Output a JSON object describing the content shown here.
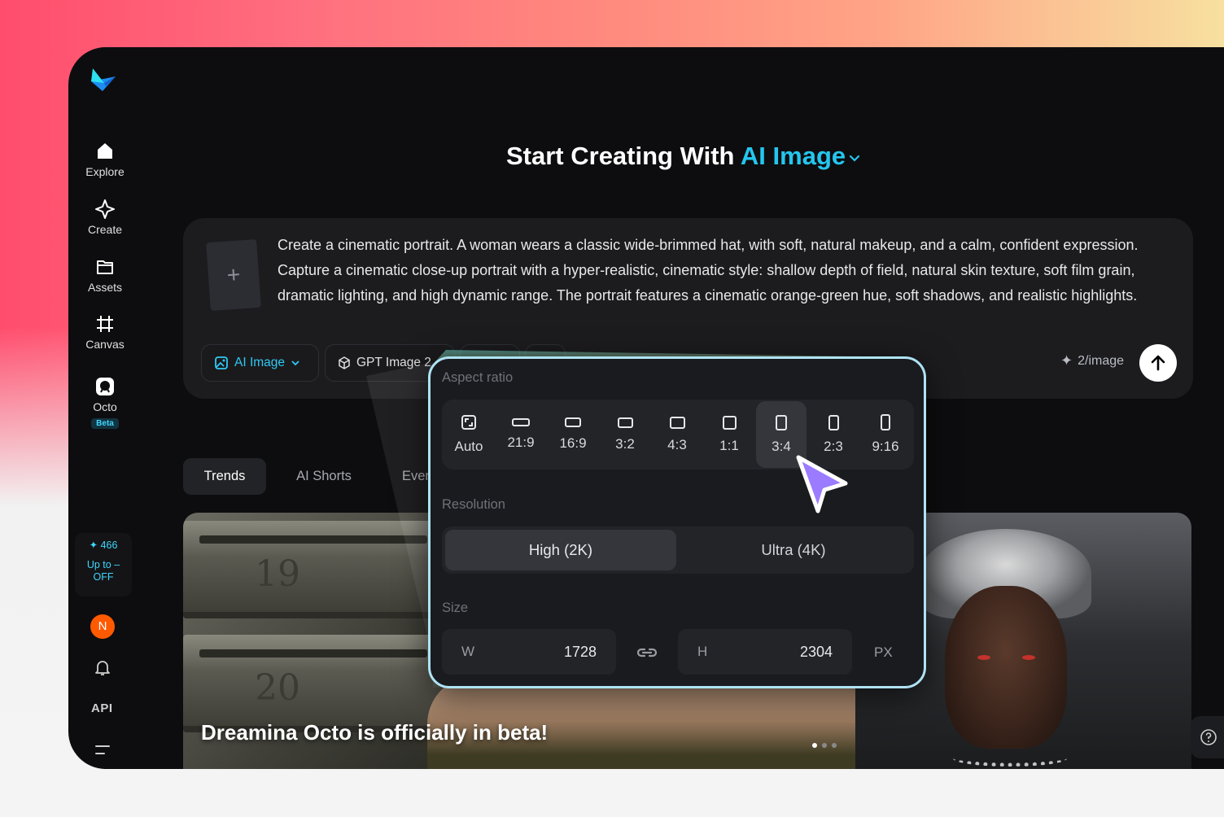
{
  "sidebar": {
    "items": [
      {
        "label": "Explore",
        "icon": "home-icon"
      },
      {
        "label": "Create",
        "icon": "sparkle-icon"
      },
      {
        "label": "Assets",
        "icon": "folder-icon"
      },
      {
        "label": "Canvas",
        "icon": "canvas-icon"
      },
      {
        "label": "Octo",
        "icon": "octo-icon",
        "badge": "Beta"
      }
    ],
    "promo": {
      "credits": "466",
      "line1": "Up to –",
      "line2": "OFF"
    },
    "avatar_letter": "N",
    "api_label": "API"
  },
  "header": {
    "prefix": "Start Creating With",
    "accent": "AI Image"
  },
  "prompt": {
    "text": "Create a cinematic portrait. A woman wears a classic wide-brimmed hat, with soft, natural makeup, and a calm, confident expression. Capture a cinematic close-up portrait with a hyper-realistic, cinematic style: shallow depth of field, natural skin texture, soft film grain, dramatic lighting, and high dynamic range. The portrait features a cinematic orange-green hue, soft shadows, and realistic highlights.",
    "add_glyph": "+",
    "chips": {
      "mode": "AI Image",
      "model": "GPT Image 2"
    },
    "price": "2/image"
  },
  "tabs": [
    {
      "label": "Trends",
      "active": true
    },
    {
      "label": "AI Shorts",
      "active": false
    },
    {
      "label": "Ever",
      "active": false
    }
  ],
  "gallery": {
    "caption": "Dreamina Octo is officially in beta!",
    "mailbox_numbers": [
      "19",
      "20"
    ]
  },
  "popup": {
    "aspect_title": "Aspect ratio",
    "ratios": [
      "Auto",
      "21:9",
      "16:9",
      "3:2",
      "4:3",
      "1:1",
      "3:4",
      "2:3",
      "9:16"
    ],
    "selected_ratio": "3:4",
    "resolution_title": "Resolution",
    "resolutions": [
      "High (2K)",
      "Ultra (4K)"
    ],
    "selected_resolution": "High (2K)",
    "size_title": "Size",
    "width_label": "W",
    "width": "1728",
    "height_label": "H",
    "height": "2304",
    "unit": "PX"
  },
  "colors": {
    "accent": "#24c6ef",
    "popup_border": "#aee3f4",
    "cursor": "#9b7bff"
  }
}
